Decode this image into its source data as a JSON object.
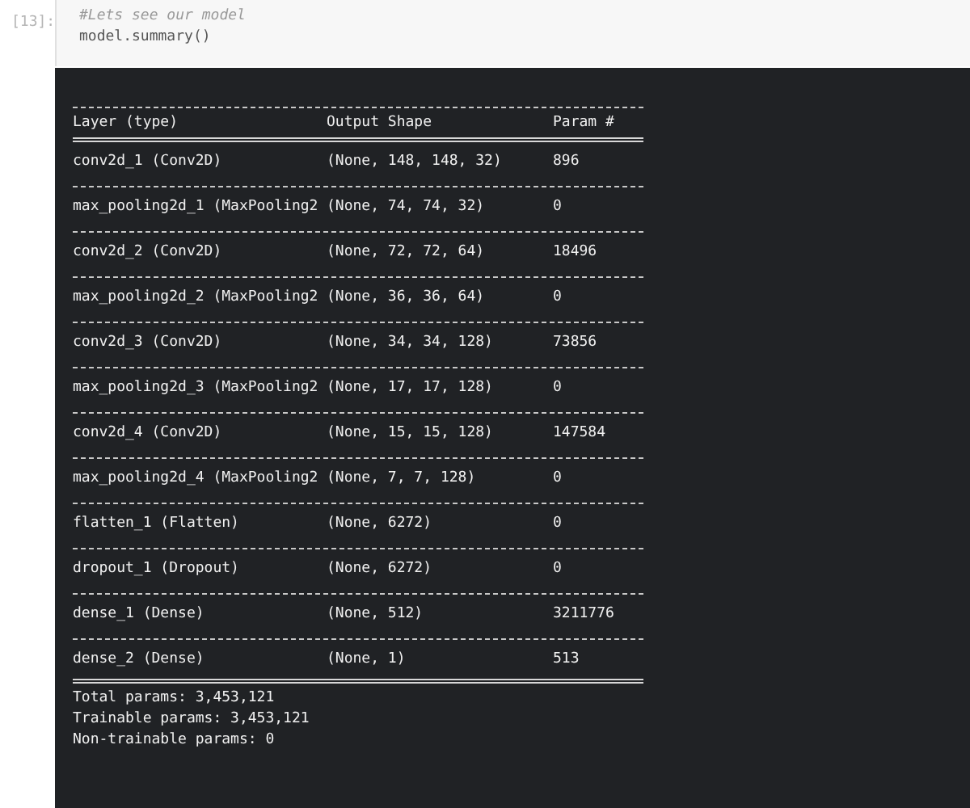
{
  "cell": {
    "prompt": "[13]:",
    "code_lines": [
      {
        "kind": "comment",
        "text": "#Lets see our model"
      },
      {
        "kind": "code",
        "text": "model.summary()"
      }
    ]
  },
  "output": {
    "columns": [
      "Layer (type)",
      "Output Shape",
      "Param #"
    ],
    "rows": [
      [
        "conv2d_1 (Conv2D)",
        "(None, 148, 148, 32)",
        "896"
      ],
      [
        "max_pooling2d_1 (MaxPooling2",
        "(None, 74, 74, 32)",
        "0"
      ],
      [
        "conv2d_2 (Conv2D)",
        "(None, 72, 72, 64)",
        "18496"
      ],
      [
        "max_pooling2d_2 (MaxPooling2",
        "(None, 36, 36, 64)",
        "0"
      ],
      [
        "conv2d_3 (Conv2D)",
        "(None, 34, 34, 128)",
        "73856"
      ],
      [
        "max_pooling2d_3 (MaxPooling2",
        "(None, 17, 17, 128)",
        "0"
      ],
      [
        "conv2d_4 (Conv2D)",
        "(None, 15, 15, 128)",
        "147584"
      ],
      [
        "max_pooling2d_4 (MaxPooling2",
        "(None, 7, 7, 128)",
        "0"
      ],
      [
        "flatten_1 (Flatten)",
        "(None, 6272)",
        "0"
      ],
      [
        "dropout_1 (Dropout)",
        "(None, 6272)",
        "0"
      ],
      [
        "dense_1 (Dense)",
        "(None, 512)",
        "3211776"
      ],
      [
        "dense_2 (Dense)",
        "(None, 1)",
        "513"
      ]
    ],
    "summary": [
      "Total params: 3,453,121",
      "Trainable params: 3,453,121",
      "Non-trainable params: 0"
    ]
  }
}
